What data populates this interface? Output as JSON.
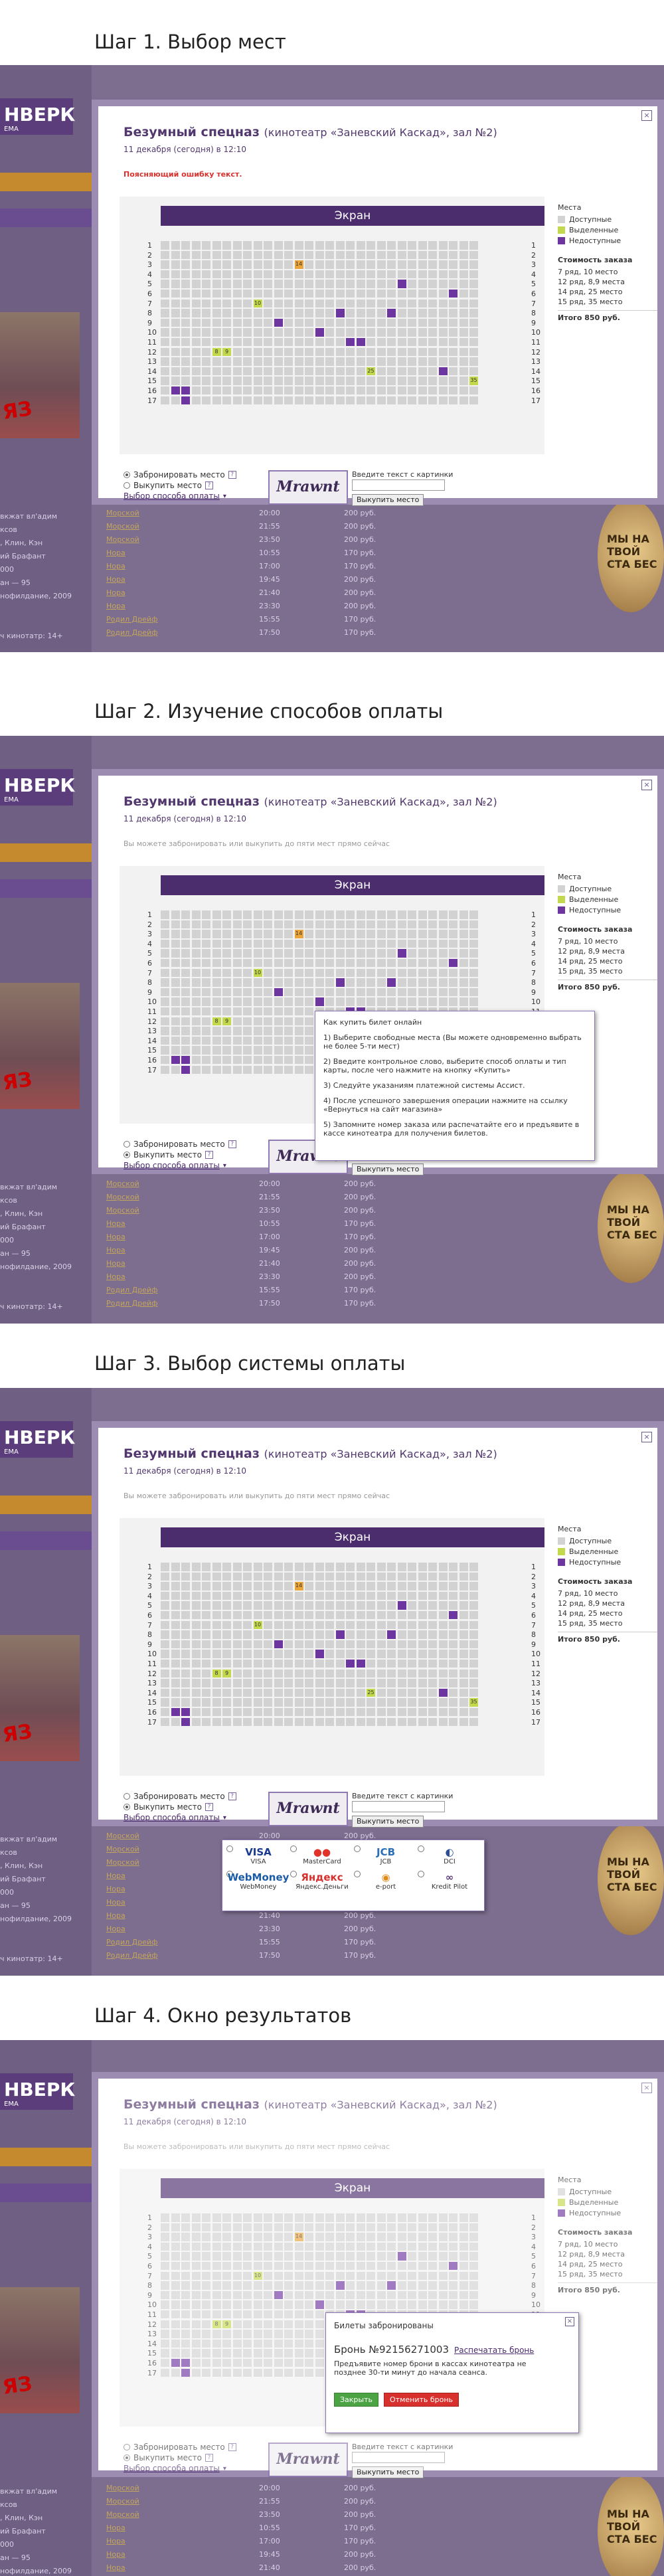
{
  "steps": [
    {
      "title": "Шаг 1. Выбор мест"
    },
    {
      "title": "Шаг 2. Изучение способов оплаты"
    },
    {
      "title": "Шаг 3. Выбор системы оплаты"
    },
    {
      "title": "Шаг 4. Окно результатов"
    }
  ],
  "modal": {
    "title": "Безумный спецназ",
    "cinema": "(кинотеатр «Заневский Каскад», зал №2)",
    "date": "11 декабря (сегодня) в 12:10",
    "error_note": "Поясняющий ошибку текст.",
    "hint_note": "Вы можете забронировать или выкупить до пяти мест прямо сейчас",
    "screen": "Экран",
    "close": "×",
    "legend_title": "Места",
    "legend": [
      {
        "label": "Доступные",
        "color": "#d2d2d2"
      },
      {
        "label": "Выделенные",
        "color": "#c3d84a"
      },
      {
        "label": "Недоступные",
        "color": "#6d35a0"
      }
    ],
    "order_title": "Стоимость заказа",
    "order_items": [
      "7 ряд, 10 место",
      "12 ряд, 8,9 места",
      "14 ряд, 25 место",
      "15 ряд, 35 место"
    ],
    "total": "Итого 850 руб.",
    "reserve_label": "Забронировать место",
    "buy_label": "Выкупить место",
    "pay_select": "Выбор способа оплаты",
    "captcha_text": "Mrawnt",
    "captcha_label": "Введите текст с картинки",
    "buy_button": "Выкупить место",
    "help": "?"
  },
  "seat_labels": {
    "hl": "14",
    "s10": "10",
    "s8": "8",
    "s9": "9",
    "s25": "25",
    "s35": "35"
  },
  "how_to": {
    "title": "Как купить билет онлайн",
    "items": [
      "1) Выберите свободные места (Вы можете одновременно выбрать не более 5-ти мест)",
      "2) Введите контрольное слово, выберите способ оплаты и тип карты, после чего нажмите на кнопку «Купить»",
      "3) Следуйте указаниям платежной системы Ассист.",
      "4) После успешного завершения операции нажмите на ссылку «Вернуться на сайт магазина»",
      "5) Запомните номер заказа или распечатайте его и предъявите в кассе кинотеатра для получения билетов."
    ]
  },
  "payment_systems": [
    {
      "mark": "VISA",
      "label": "VISA",
      "color": "#1a3a8f"
    },
    {
      "mark": "●●",
      "label": "MasterCard",
      "color": "#e0342a"
    },
    {
      "mark": "JCB",
      "label": "JCB",
      "color": "#2a6fb8"
    },
    {
      "mark": "◐",
      "label": "DCI",
      "color": "#2a4f94"
    },
    {
      "mark": "WebMoney",
      "label": "WebMoney",
      "color": "#1a5ca8"
    },
    {
      "mark": "Яндекс",
      "label": "Яндекс.Деньги",
      "color": "#d8302c"
    },
    {
      "mark": "◉",
      "label": "e-port",
      "color": "#e08a1a"
    },
    {
      "mark": "∞",
      "label": "Kredit Pilot",
      "color": "#5a3d7a"
    }
  ],
  "result": {
    "title": "Билеты забронированы",
    "number": "Бронь №92156271003",
    "print": "Распечатать бронь",
    "info": "Предъявите номер брони в кассах кинотеатра не позднее 30-ти минут до начала сеанса.",
    "ok": "Закрыть",
    "cancel": "Отменить бронь"
  },
  "background": {
    "logo": "НВЕРК",
    "logo_sub": "ЕМА",
    "poster_text": "ЯЗ",
    "ad_text": "МЫ НА ТВОЙ СТА БЕС",
    "left_text": [
      "вкжат вл'адим",
      "ксов",
      ", Клин, Кэн",
      "ий Брафант",
      "000",
      "ан — 95",
      "нофилдание, 2009",
      "",
      "",
      "ч кинотатр: 14+"
    ],
    "rows": [
      {
        "c1": "Морской",
        "c2": "20:00",
        "c3": "200 руб."
      },
      {
        "c1": "Морской",
        "c2": "21:55",
        "c3": "200 руб."
      },
      {
        "c1": "Морской",
        "c2": "23:50",
        "c3": "200 руб."
      },
      {
        "c1": "Нора",
        "c2": "10:55",
        "c3": "170 руб."
      },
      {
        "c1": "Нора",
        "c2": "17:00",
        "c3": "170 руб."
      },
      {
        "c1": "Нора",
        "c2": "19:45",
        "c3": "200 руб."
      },
      {
        "c1": "Нора",
        "c2": "21:40",
        "c3": "200 руб."
      },
      {
        "c1": "Нора",
        "c2": "23:30",
        "c3": "200 руб."
      },
      {
        "c1": "Родил Дрейф",
        "c2": "15:55",
        "c3": "170 руб."
      },
      {
        "c1": "Родил Дрейф",
        "c2": "17:50",
        "c3": "170 руб."
      }
    ]
  }
}
